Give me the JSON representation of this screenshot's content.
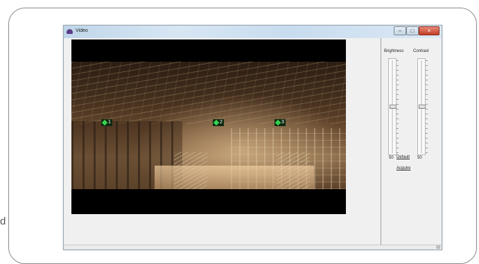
{
  "margin_text": "d",
  "window": {
    "title": "Video",
    "buttons": {
      "minimize": "–",
      "maximize": "□",
      "close": "×"
    }
  },
  "video": {
    "markers": [
      {
        "label": "1"
      },
      {
        "label": "2"
      },
      {
        "label": "3"
      }
    ]
  },
  "controls": {
    "brightness_label": "Brightness",
    "contrast_label": "Contrast",
    "brightness_value": "50",
    "contrast_value": "50",
    "brightness_level": 0.5,
    "contrast_level": 0.5,
    "default_button": "Default",
    "acquire_button": "Acquire"
  },
  "colors": {
    "marker": "#39d24f",
    "close_button": "#c23c25"
  }
}
